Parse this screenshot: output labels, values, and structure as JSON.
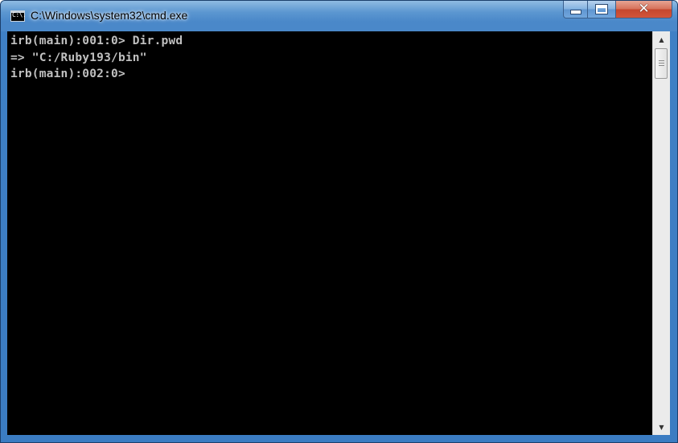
{
  "window": {
    "title": "C:\\Windows\\system32\\cmd.exe",
    "icon_name": "cmd-icon",
    "icon_text": "C:\\."
  },
  "caption_buttons": {
    "minimize_icon": "minimize-icon",
    "maximize_icon": "maximize-icon",
    "close_icon": "close-icon",
    "close_glyph": "✕"
  },
  "console": {
    "lines": [
      "irb(main):001:0> Dir.pwd",
      "=> \"C:/Ruby193/bin\"",
      "irb(main):002:0>"
    ],
    "background_color": "#000000",
    "text_color": "#c0c0c0"
  },
  "scrollbar": {
    "up_glyph": "▲",
    "down_glyph": "▼"
  }
}
